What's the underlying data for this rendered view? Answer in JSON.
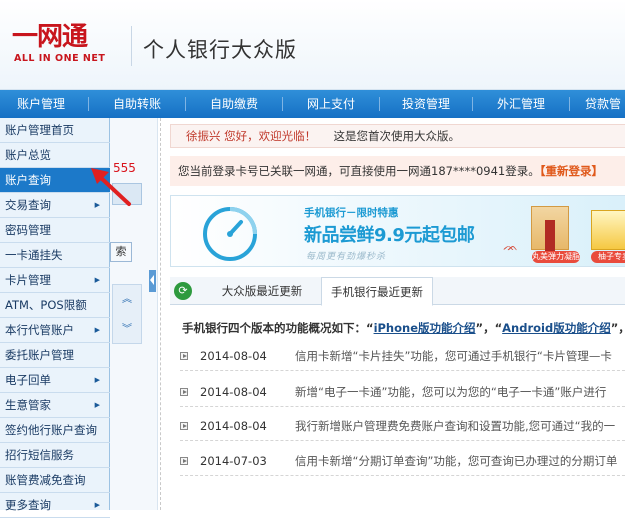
{
  "header": {
    "logo_text": "一网通",
    "logo_subtext": "ALL IN ONE NET",
    "app_title": "个人银行大众版"
  },
  "nav": {
    "items": [
      "账户管理",
      "自助转账",
      "自助缴费",
      "网上支付",
      "投资管理",
      "外汇管理",
      "贷款管"
    ]
  },
  "dropdown": {
    "items": [
      {
        "label": "账户管理首页",
        "has_arrow": false
      },
      {
        "label": "账户总览",
        "has_arrow": false
      },
      {
        "label": "账户查询",
        "has_arrow": false,
        "active": true
      },
      {
        "label": "交易查询",
        "has_arrow": true
      },
      {
        "label": "密码管理",
        "has_arrow": false
      },
      {
        "label": "一卡通挂失",
        "has_arrow": false
      },
      {
        "label": "卡片管理",
        "has_arrow": true
      },
      {
        "label": "ATM、POS限额",
        "has_arrow": false
      },
      {
        "label": "本行代管账户",
        "has_arrow": true
      },
      {
        "label": "委托账户管理",
        "has_arrow": false
      },
      {
        "label": "电子回单",
        "has_arrow": true
      },
      {
        "label": "生意管家",
        "has_arrow": true
      },
      {
        "label": "签约他行账户查询",
        "has_arrow": false
      },
      {
        "label": "招行短信服务",
        "has_arrow": false
      },
      {
        "label": "账管费减免查询",
        "has_arrow": false
      },
      {
        "label": "更多查询",
        "has_arrow": true
      }
    ]
  },
  "left_panel": {
    "number": "555",
    "search_label": "索"
  },
  "welcome": {
    "user_greeting": "徐振兴 您好，欢迎光临！",
    "message": "这是您首次使用大众版。"
  },
  "login_info": {
    "text": "您当前登录卡号已关联一网通，可直接使用一网通187****0941登录。",
    "relogin_label": "【重新登录】"
  },
  "banner": {
    "line1": "手机银行－限时特惠",
    "line2": "新品尝鲜9.9元起包邮",
    "line3": "每周更有劲爆秒杀",
    "product1_label": "丸美弹力凝脂",
    "product2_label": "柚子专卖"
  },
  "tabs": {
    "tab1": "大众版最近更新",
    "tab2": "手机银行最近更新"
  },
  "overview": {
    "prefix": "手机银行四个版本的功能概况如下：",
    "link1": "iPhone版功能介绍",
    "sep": "，",
    "link2": "Android版功能介绍",
    "suffix": "，"
  },
  "news": [
    {
      "date": "2014-08-04",
      "text": "信用卡新增“卡片挂失”功能，您可通过手机银行“卡片管理—卡"
    },
    {
      "date": "2014-08-04",
      "text": "新增“电子一卡通”功能，您可以为您的“电子一卡通”账户进行"
    },
    {
      "date": "2014-08-04",
      "text": "我行新增账户管理费免费账户查询和设置功能,您可通过“我的一"
    },
    {
      "date": "2014-07-03",
      "text": "信用卡新增“分期订单查询”功能，您可查询已办理过的分期订单"
    }
  ],
  "colors": {
    "nav_blue": "#1c79c9",
    "logo_red": "#c8151d",
    "relogin_orange": "#e0591b",
    "banner_text": "#1c9ad3"
  }
}
